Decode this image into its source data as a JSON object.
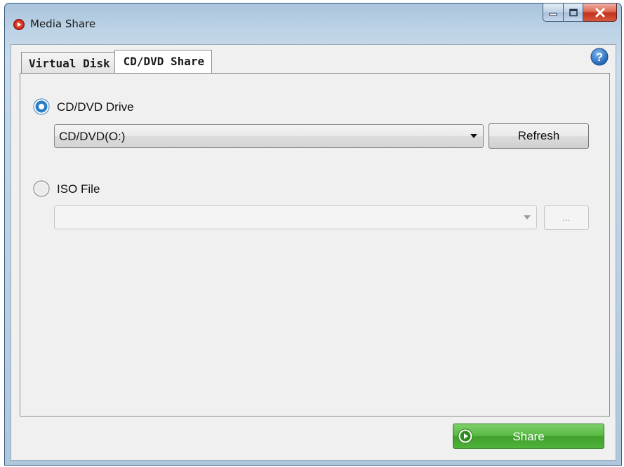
{
  "window": {
    "title": "Media Share",
    "app_icon": "media-share-app-icon",
    "controls": {
      "minimize": "minimize-icon",
      "maximize": "maximize-icon",
      "close": "close-icon"
    }
  },
  "tabs": [
    {
      "label": "Virtual Disk",
      "selected": false
    },
    {
      "label": "CD/DVD Share",
      "selected": true
    }
  ],
  "help": {
    "icon": "help-icon",
    "glyph": "?"
  },
  "cd_drive": {
    "label": "CD/DVD Drive",
    "selected": true,
    "value": "CD/DVD(O:)",
    "refresh_label": "Refresh"
  },
  "iso_file": {
    "label": "ISO File",
    "selected": false,
    "value": "",
    "browse_label": "..."
  },
  "share": {
    "label": "Share",
    "icon": "play-icon"
  },
  "colors": {
    "accent_radio": "#2a7fc4",
    "share_green": "#4fb23a",
    "help_blue": "#2d6fc1"
  }
}
